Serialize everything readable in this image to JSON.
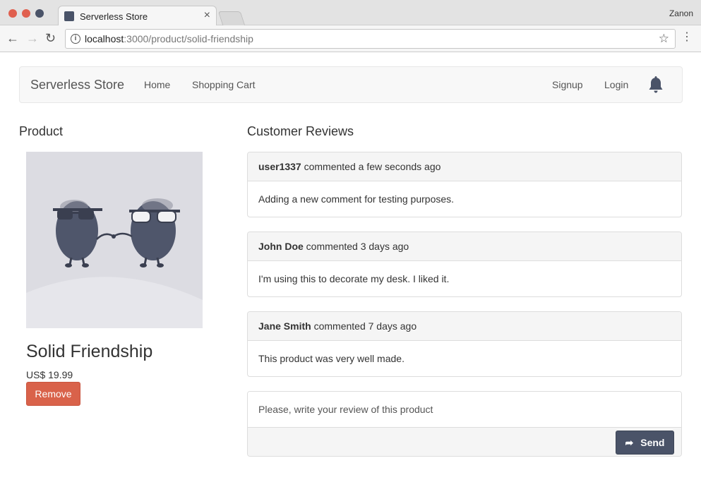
{
  "browser": {
    "tab_title": "Serverless Store",
    "profile_name": "Zanon",
    "url_host": "localhost",
    "url_path": ":3000/product/solid-friendship"
  },
  "navbar": {
    "brand": "Serverless Store",
    "home": "Home",
    "cart": "Shopping Cart",
    "signup": "Signup",
    "login": "Login"
  },
  "product": {
    "section_title": "Product",
    "name": "Solid Friendship",
    "price": "US$ 19.99",
    "remove_label": "Remove"
  },
  "reviews": {
    "section_title": "Customer Reviews",
    "items": [
      {
        "author": "user1337",
        "meta": "commented a few seconds ago",
        "text": "Adding a new comment for testing purposes."
      },
      {
        "author": "John Doe",
        "meta": "commented 3 days ago",
        "text": "I'm using this to decorate my desk. I liked it."
      },
      {
        "author": "Jane Smith",
        "meta": "commented 7 days ago",
        "text": "This product was very well made."
      }
    ],
    "input_placeholder": "Please, write your review of this product",
    "send_label": "Send"
  },
  "colors": {
    "accent": "#4a5368",
    "danger": "#d9624a"
  },
  "icons": [
    "info-icon",
    "star-icon",
    "bell-icon",
    "share-arrow-icon",
    "close-icon"
  ]
}
